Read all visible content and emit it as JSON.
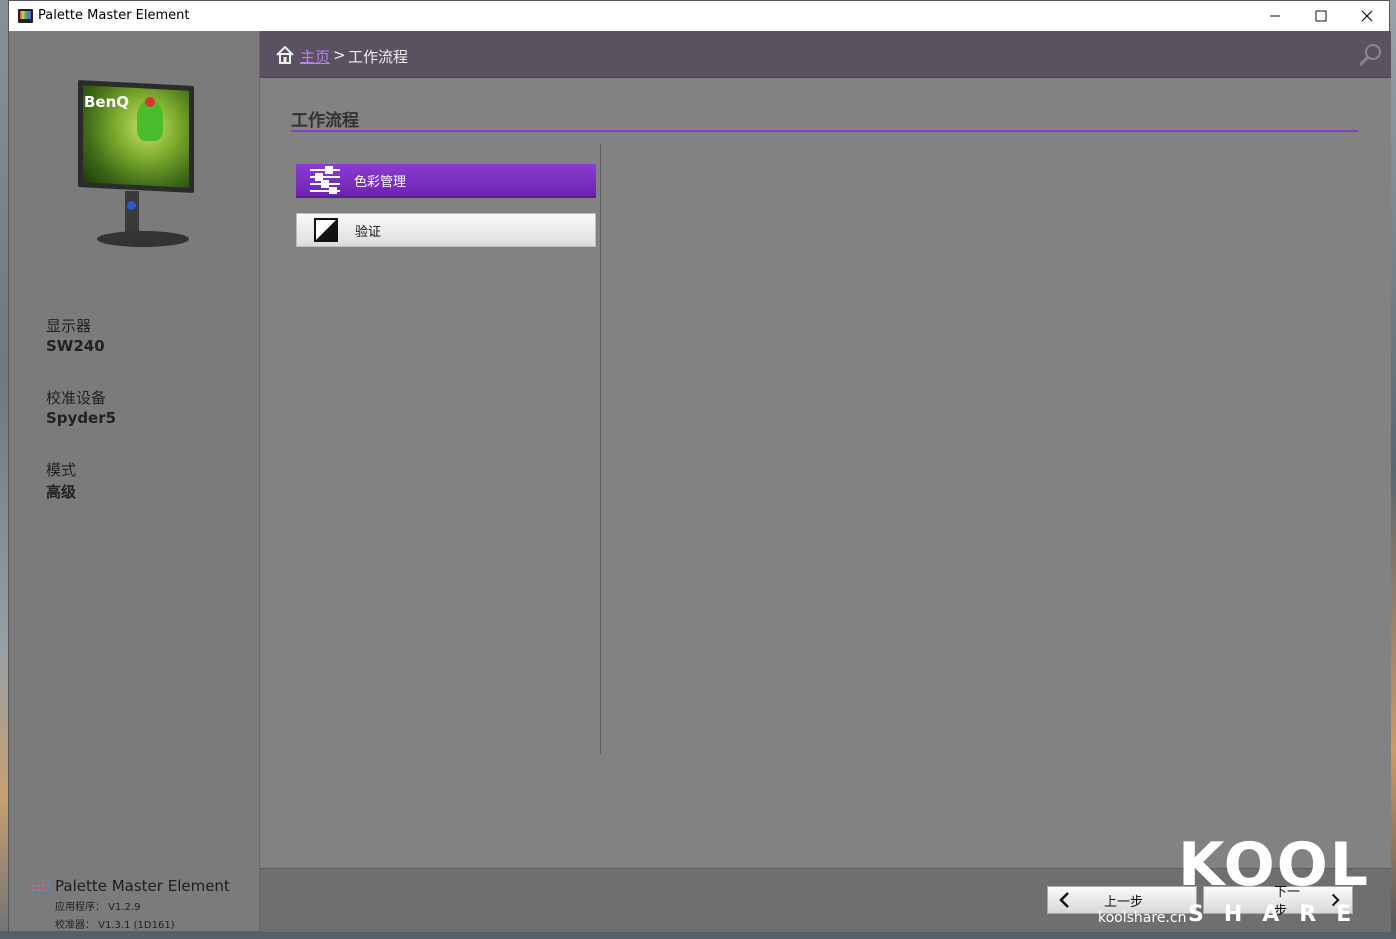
{
  "window": {
    "title": "Palette Master Element"
  },
  "window_controls": {
    "minimize": "—",
    "maximize": "☐",
    "close": "✕"
  },
  "sidebar": {
    "display_label": "显示器",
    "display_value": "SW240",
    "device_label": "校准设备",
    "device_value": "Spyder5",
    "mode_label": "模式",
    "mode_value": "高级",
    "monitor_logo": "BenQ",
    "brand_name": "Palette Master Element",
    "app_version": "应用程序： V1.2.9",
    "calibrator_version": "校准器： V1.3.1 (1D161)"
  },
  "breadcrumb": {
    "home": "主页",
    "separator": ">",
    "current": "工作流程"
  },
  "main": {
    "section_title": "工作流程",
    "workflow_items": [
      {
        "label": "色彩管理",
        "active": true
      },
      {
        "label": "验证",
        "active": false
      }
    ]
  },
  "footer": {
    "prev_label": "上一步",
    "next_label": "下一步"
  },
  "watermark": {
    "brand": "KOOL",
    "sub": "SHARE",
    "url": "koolshare.cn"
  },
  "colors": {
    "accent": "#7a2fc0",
    "link": "#c07cff",
    "topbar": "#5a5260"
  }
}
